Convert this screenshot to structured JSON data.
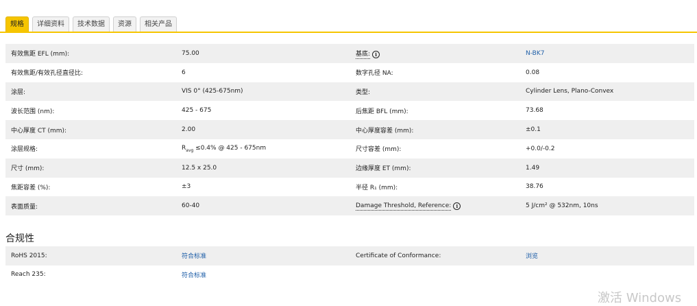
{
  "tabs": [
    "规格",
    "详细资料",
    "技术数据",
    "资源",
    "相关产品"
  ],
  "specs": {
    "left": [
      {
        "label": "有效焦距 EFL (mm):",
        "value": "75.00"
      },
      {
        "label": "有效焦距/有效孔径直径比:",
        "value": "6"
      },
      {
        "label": "涂层:",
        "value": "VIS 0° (425-675nm)"
      },
      {
        "label": "波长范围 (nm):",
        "value": "425 - 675"
      },
      {
        "label": "中心厚度 CT (mm):",
        "value": "2.00"
      },
      {
        "label": "涂层规格:",
        "value_prefix": "R",
        "value_sub": "avg",
        "value_suffix": " ≤0.4% @ 425 - 675nm"
      },
      {
        "label": "尺寸 (mm):",
        "value": "12.5 x 25.0"
      },
      {
        "label": "焦距容差 (%):",
        "value": "±3"
      },
      {
        "label": "表面质量:",
        "value": "60-40"
      }
    ],
    "right": [
      {
        "label": "基底:",
        "value": "N-BK7"
      },
      {
        "label": "数字孔径 NA:",
        "value": "0.08"
      },
      {
        "label": "类型:",
        "value": "Cylinder Lens, Plano-Convex"
      },
      {
        "label": "后焦距 BFL (mm):",
        "value": "73.68"
      },
      {
        "label": "中心厚度容差 (mm):",
        "value": "±0.1"
      },
      {
        "label": "尺寸容差 (mm):",
        "value": "+0.0/-0.2"
      },
      {
        "label": "边缘厚度 ET (mm):",
        "value": "1.49"
      },
      {
        "label": "半径 R₁ (mm):",
        "value": "38.76"
      },
      {
        "label": "Damage Threshold, Reference:",
        "value": "5 J/cm² @ 532nm, 10ns"
      }
    ]
  },
  "compliance": {
    "title": "合规性",
    "rows": [
      {
        "label": "RoHS 2015:",
        "value": "符合标准",
        "label2": "Certificate of Conformance:",
        "value2": "浏览"
      },
      {
        "label": "Reach 235:",
        "value": "符合标准"
      }
    ]
  },
  "watermark": "激活 Windows",
  "colors": {
    "accent": "#f6c500",
    "link": "#1f5fa8",
    "row_shade": "#efefef"
  }
}
